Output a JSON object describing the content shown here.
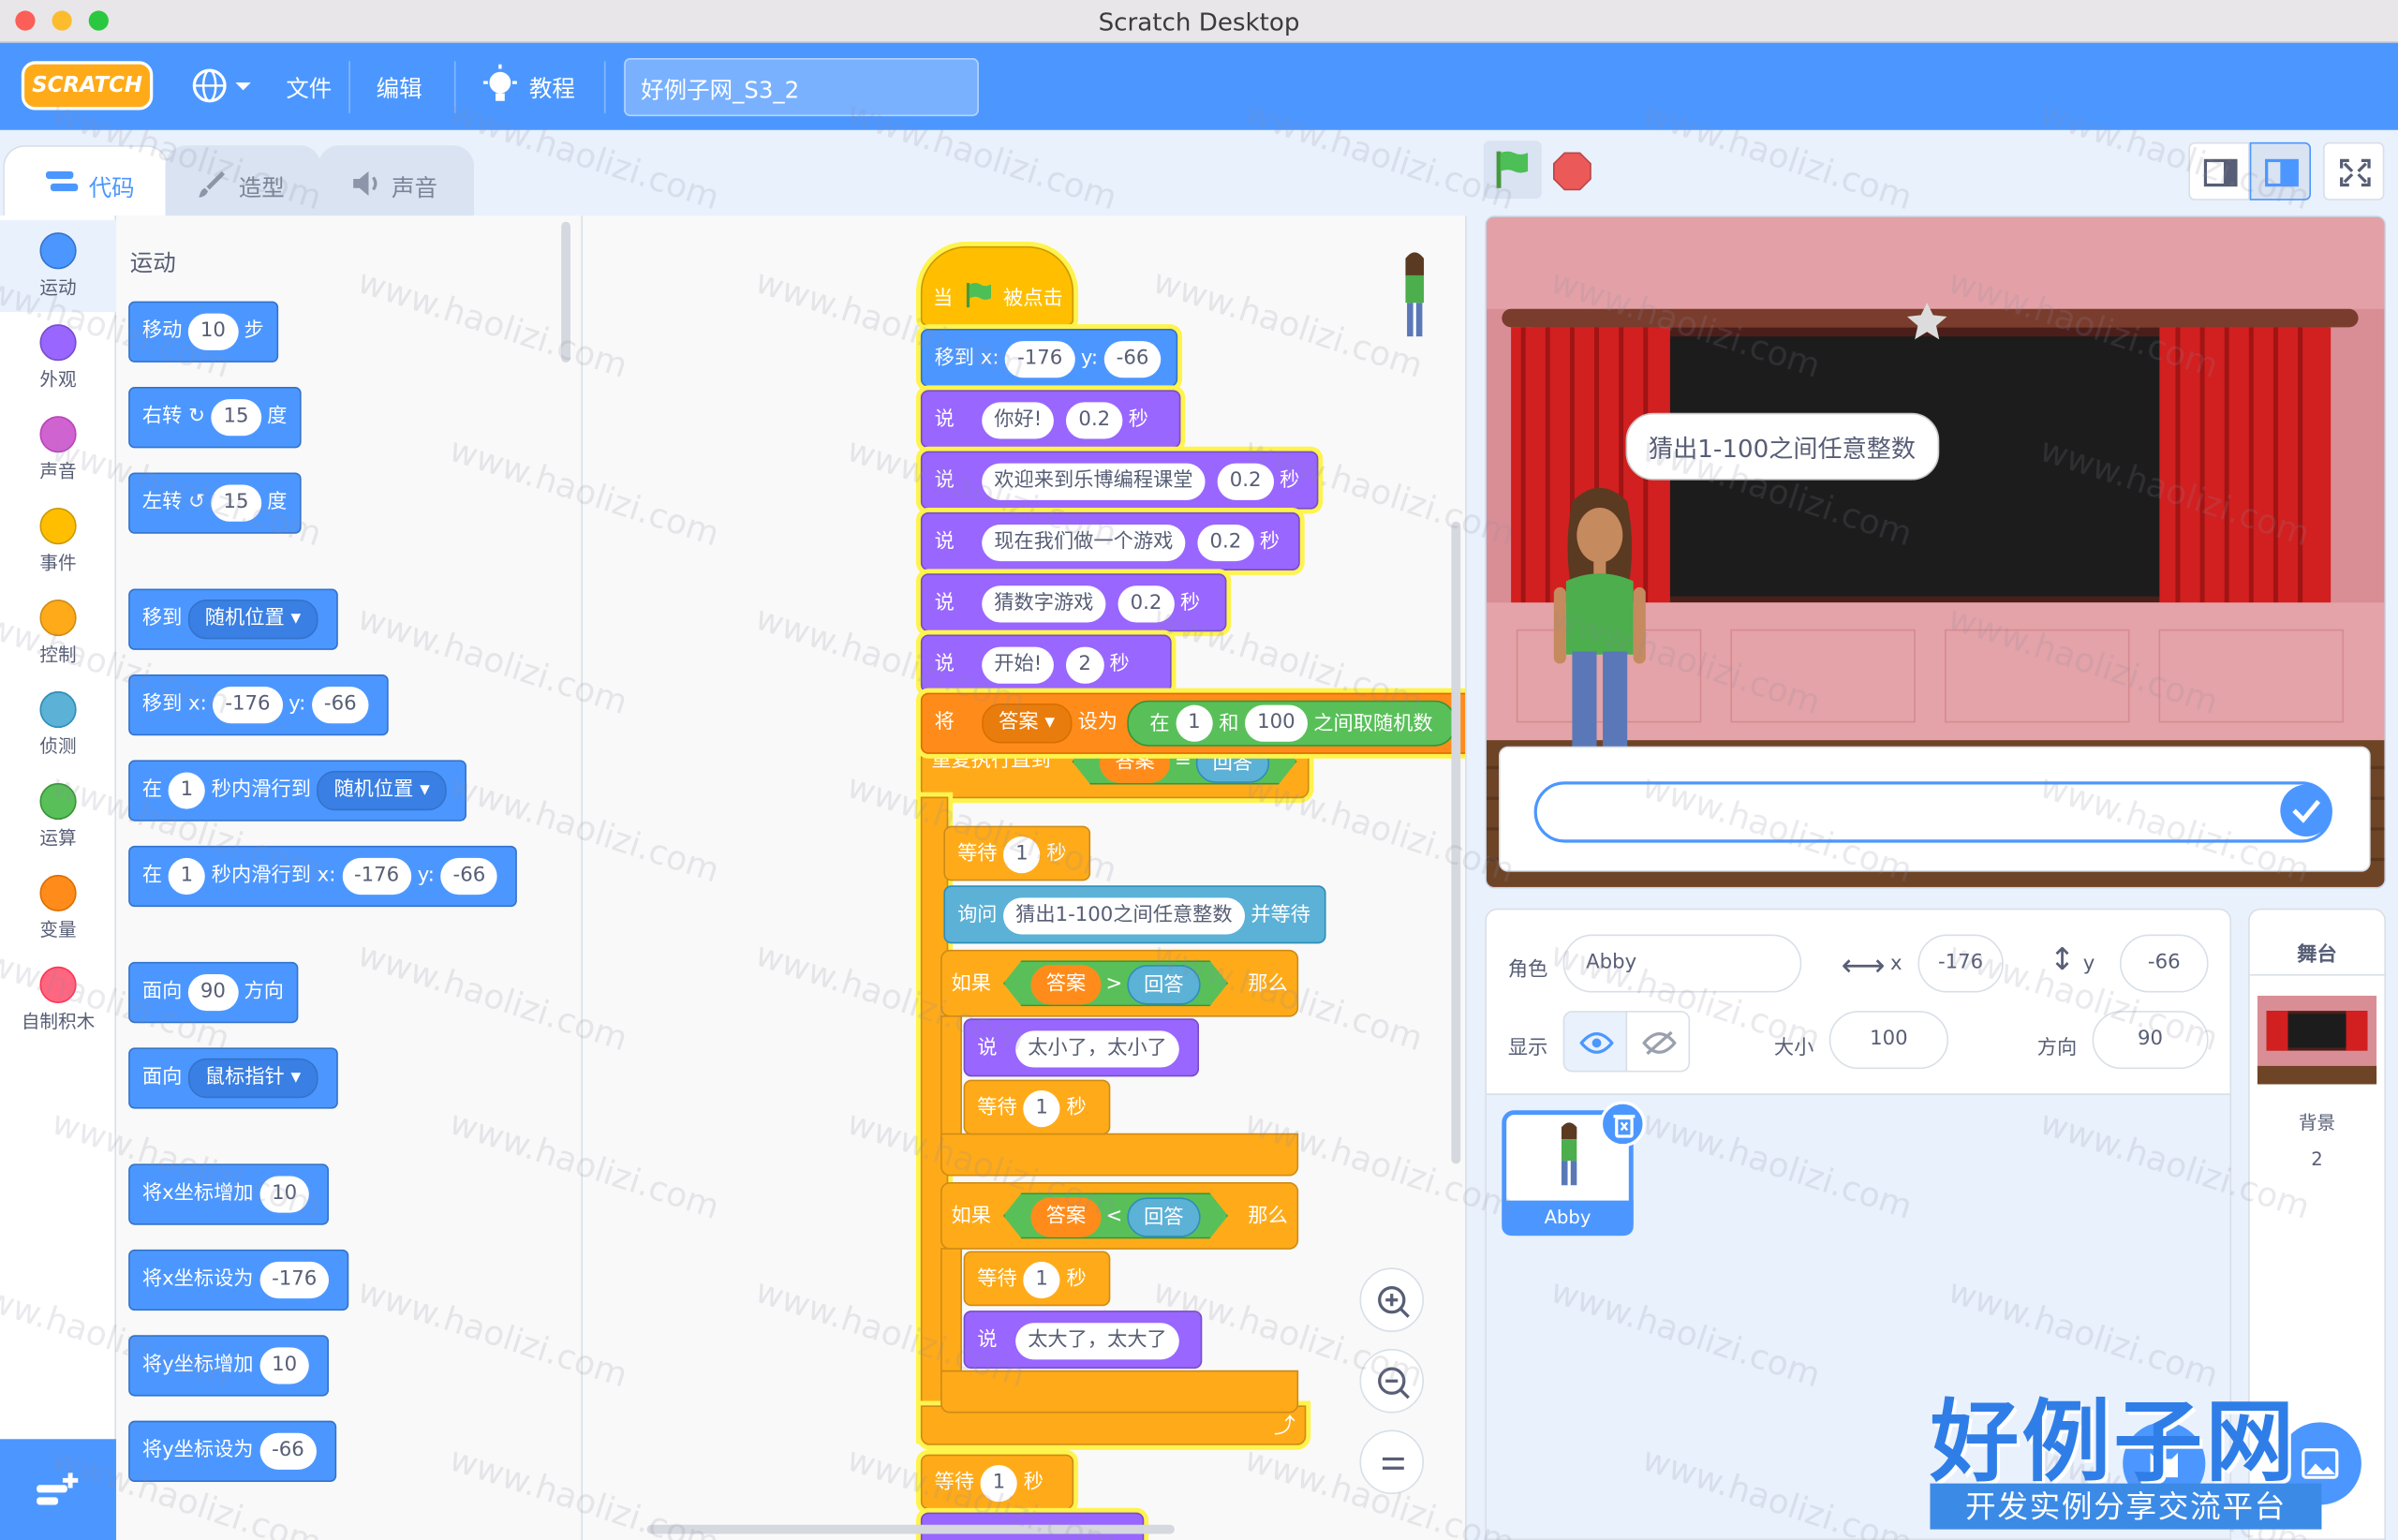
{
  "window": {
    "title": "Scratch Desktop"
  },
  "menubar": {
    "logo": "SCRATCH",
    "file": "文件",
    "edit": "编辑",
    "tutorials": "教程",
    "project_name": "好例子网_S3_2"
  },
  "tabs": {
    "code": "代码",
    "costumes": "造型",
    "sounds": "声音"
  },
  "categories": [
    {
      "label": "运动",
      "color": "#4c97ff"
    },
    {
      "label": "外观",
      "color": "#9966ff"
    },
    {
      "label": "声音",
      "color": "#cf63cf"
    },
    {
      "label": "事件",
      "color": "#ffbf00"
    },
    {
      "label": "控制",
      "color": "#ffab19"
    },
    {
      "label": "侦测",
      "color": "#5cb1d6"
    },
    {
      "label": "运算",
      "color": "#59c059"
    },
    {
      "label": "变量",
      "color": "#ff8c1a"
    },
    {
      "label": "自制积木",
      "color": "#ff6680"
    }
  ],
  "palette": {
    "heading": "运动",
    "move": {
      "a": "移动",
      "v": "10",
      "b": "步"
    },
    "turn_right": {
      "a": "右转",
      "v": "15",
      "b": "度"
    },
    "turn_left": {
      "a": "左转",
      "v": "15",
      "b": "度"
    },
    "goto": {
      "a": "移到",
      "v": "随机位置"
    },
    "goto_xy": {
      "a": "移到 x:",
      "x": "-176",
      "ylab": "y:",
      "y": "-66"
    },
    "glide": {
      "a": "在",
      "v": "1",
      "b": "秒内滑行到",
      "c": "随机位置"
    },
    "glide_xy": {
      "a": "在",
      "v": "1",
      "b": "秒内滑行到 x:",
      "x": "-176",
      "ylab": "y:",
      "y": "-66"
    },
    "point_dir": {
      "a": "面向",
      "v": "90",
      "b": "方向"
    },
    "point_to": {
      "a": "面向",
      "v": "鼠标指针"
    },
    "change_x": {
      "a": "将x坐标增加",
      "v": "10"
    },
    "set_x": {
      "a": "将x坐标设为",
      "v": "-176"
    },
    "change_y": {
      "a": "将y坐标增加",
      "v": "10"
    },
    "set_y": {
      "a": "将y坐标设为",
      "v": "-66"
    }
  },
  "script": {
    "hat": {
      "a": "当",
      "b": "被点击"
    },
    "goto": {
      "a": "移到 x:",
      "x": "-176",
      "ylab": "y:",
      "y": "-66"
    },
    "say1": {
      "a": "说",
      "t": "你好!",
      "s": "0.2",
      "b": "秒"
    },
    "say2": {
      "a": "说",
      "t": "欢迎来到乐博编程课堂",
      "s": "0.2",
      "b": "秒"
    },
    "say3": {
      "a": "说",
      "t": "现在我们做一个游戏",
      "s": "0.2",
      "b": "秒"
    },
    "say4": {
      "a": "说",
      "t": "猜数字游戏",
      "s": "0.2",
      "b": "秒"
    },
    "say5": {
      "a": "说",
      "t": "开始!",
      "s": "2",
      "b": "秒"
    },
    "setvar": {
      "a": "将",
      "var": "答案",
      "b": "设为",
      "c": "在",
      "lo": "1",
      "d": "和",
      "hi": "100",
      "e": "之间取随机数"
    },
    "repeat": {
      "a": "重复执行直到",
      "l": "答案",
      "op": "=",
      "r": "回答"
    },
    "wait1": {
      "a": "等待",
      "v": "1",
      "b": "秒"
    },
    "ask": {
      "a": "询问",
      "q": "猜出1-100之间任意整数",
      "b": "并等待"
    },
    "if1": {
      "a": "如果",
      "l": "答案",
      "op": ">",
      "r": "回答",
      "b": "那么"
    },
    "say_small": {
      "a": "说",
      "t": "太小了，太小了"
    },
    "wait2": {
      "a": "等待",
      "v": "1",
      "b": "秒"
    },
    "if2": {
      "a": "如果",
      "l": "答案",
      "op": "<",
      "r": "回答",
      "b": "那么"
    },
    "wait3": {
      "a": "等待",
      "v": "1",
      "b": "秒"
    },
    "say_big": {
      "a": "说",
      "t": "太大了，太大了"
    },
    "wait4": {
      "a": "等待",
      "v": "1",
      "b": "秒"
    }
  },
  "stage": {
    "speech": "猜出1-100之间任意整数",
    "answer_value": ""
  },
  "sprite_info": {
    "sprite_label": "角色",
    "sprite_name": "Abby",
    "x_label": "x",
    "x": "-176",
    "y_label": "y",
    "y": "-66",
    "show_label": "显示",
    "size_label": "大小",
    "size": "100",
    "dir_label": "方向",
    "dir": "90"
  },
  "sprites": [
    {
      "name": "Abby"
    }
  ],
  "stage_pane": {
    "title": "舞台",
    "backdrop_label": "背景",
    "backdrop_count": "2"
  },
  "watermark": {
    "url": "www.haolizi.com",
    "brand": "好例子网",
    "slogan": "开发实例分享交流平台"
  }
}
